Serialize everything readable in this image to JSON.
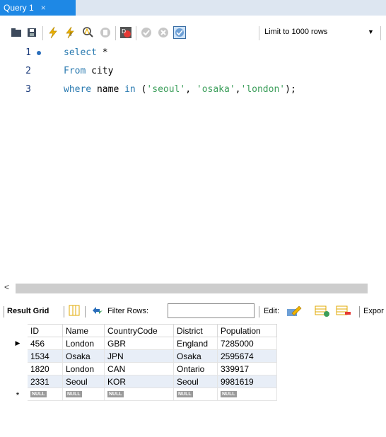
{
  "tab": {
    "title": "Query 1",
    "close_glyph": "×"
  },
  "toolbar": {
    "icons": [
      "open-folder-icon",
      "save-icon",
      "execute-icon",
      "execute-current-icon",
      "explain-icon",
      "stop-icon",
      "toggle-error-icon",
      "commit-icon",
      "rollback-icon",
      "autocommit-icon"
    ],
    "limit_label": "Limit to 1000 rows"
  },
  "editor": {
    "lines": [
      {
        "number": "1"
      },
      {
        "number": "2"
      },
      {
        "number": "3"
      }
    ],
    "tokens": {
      "l1_kw": "select",
      "l1_rest": " *",
      "l2_kw": "From",
      "l2_rest": " city",
      "l3_kw1": "where",
      "l3_mid1": " name ",
      "l3_kw2": "in",
      "l3_mid2": " (",
      "l3_s1": "'seoul'",
      "l3_c1": ", ",
      "l3_s2": "'osaka'",
      "l3_c2": ",",
      "l3_s3": "'london'",
      "l3_end": ");"
    }
  },
  "results": {
    "result_grid_label": "Result Grid",
    "filter_label": "Filter Rows:",
    "filter_value": "",
    "edit_label": "Edit:",
    "export_label": "Expor",
    "columns": [
      "ID",
      "Name",
      "CountryCode",
      "District",
      "Population"
    ],
    "rows": [
      [
        "456",
        "London",
        "GBR",
        "England",
        "7285000"
      ],
      [
        "1534",
        "Osaka",
        "JPN",
        "Osaka",
        "2595674"
      ],
      [
        "1820",
        "London",
        "CAN",
        "Ontario",
        "339917"
      ],
      [
        "2331",
        "Seoul",
        "KOR",
        "Seoul",
        "9981619"
      ]
    ],
    "new_row_marker": "*",
    "null_label": "NULL",
    "current_row_marker": "▶"
  },
  "colors": {
    "tab_active": "#1e88e5",
    "keyword": "#2a7ab0",
    "string": "#3b9e5a",
    "alt_row": "#e8eef7"
  }
}
